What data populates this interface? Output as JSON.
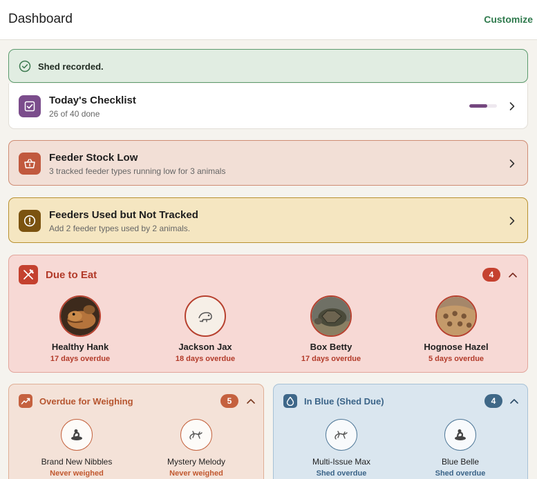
{
  "header": {
    "title": "Dashboard",
    "customize_label": "Customize"
  },
  "toast": {
    "message": "Shed recorded."
  },
  "checklist": {
    "title": "Today's Checklist",
    "subtitle": "26 of 40 done",
    "progress_fraction": 0.65,
    "accent": "#7b4d8c"
  },
  "feeder_stock": {
    "title": "Feeder Stock Low",
    "subtitle": "3 tracked feeder types running low for 3 animals",
    "accent": "#c1593e"
  },
  "feeders_untracked": {
    "title": "Feeders Used but Not Tracked",
    "subtitle": "Add 2 feeder types used by 2 animals.",
    "accent": "#7b5310"
  },
  "due_to_eat": {
    "title": "Due to Eat",
    "count": "4",
    "animals": [
      {
        "name": "Healthy Hank",
        "status": "17 days overdue",
        "icon": "lizard-photo"
      },
      {
        "name": "Jackson Jax",
        "status": "18 days overdue",
        "icon": "chameleon-icon"
      },
      {
        "name": "Box Betty",
        "status": "17 days overdue",
        "icon": "tortoise-photo"
      },
      {
        "name": "Hognose Hazel",
        "status": "5 days overdue",
        "icon": "snake-photo"
      }
    ]
  },
  "overdue_weighing": {
    "title": "Overdue for Weighing",
    "count": "5",
    "animals": [
      {
        "name": "Brand New Nibbles",
        "status": "Never weighed",
        "icon": "snake-coil-icon"
      },
      {
        "name": "Mystery Melody",
        "status": "Never weighed",
        "icon": "gecko-icon"
      }
    ]
  },
  "in_blue": {
    "title": "In Blue (Shed Due)",
    "count": "4",
    "animals": [
      {
        "name": "Multi-Issue Max",
        "status": "Shed overdue",
        "icon": "gecko-icon"
      },
      {
        "name": "Blue Belle",
        "status": "Shed overdue",
        "icon": "snake-coil-icon"
      }
    ]
  }
}
